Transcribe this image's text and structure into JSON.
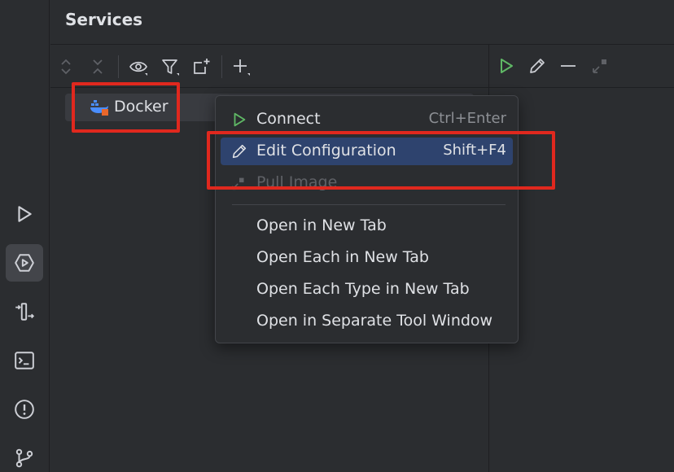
{
  "panel": {
    "title": "Services"
  },
  "left_strip": {
    "icons": [
      "run-icon",
      "services-icon",
      "deploy-icon",
      "terminal-icon",
      "problems-icon",
      "git-icon"
    ],
    "active": "services-icon"
  },
  "toolbar": {
    "icons": [
      "expand-all-icon",
      "collapse-all-icon",
      "eye-icon",
      "filter-icon",
      "new-group-icon",
      "add-icon"
    ]
  },
  "tree": {
    "items": [
      {
        "label": "Docker",
        "icon": "docker-icon",
        "selected": true
      }
    ]
  },
  "context_menu": {
    "items": [
      {
        "label": "Connect",
        "shortcut": "Ctrl+Enter",
        "icon": "run-icon",
        "enabled": true,
        "selected": false
      },
      {
        "label": "Edit Configuration",
        "shortcut": "Shift+F4",
        "icon": "pencil-icon",
        "enabled": true,
        "selected": true
      },
      {
        "label": "Pull Image",
        "shortcut": "",
        "icon": "pull-image-icon",
        "enabled": false,
        "selected": false
      },
      {
        "label": "Open in New Tab",
        "shortcut": "",
        "icon": "",
        "enabled": true,
        "selected": false
      },
      {
        "label": "Open Each in New Tab",
        "shortcut": "",
        "icon": "",
        "enabled": true,
        "selected": false
      },
      {
        "label": "Open Each Type in New Tab",
        "shortcut": "",
        "icon": "",
        "enabled": true,
        "selected": false
      },
      {
        "label": "Open in Separate Tool Window",
        "shortcut": "",
        "icon": "",
        "enabled": true,
        "selected": false
      }
    ]
  },
  "right_toolbar": {
    "icons": [
      "run-icon",
      "pencil-icon",
      "minus-icon",
      "expand-icon"
    ]
  },
  "colors": {
    "background": "#2b2d30",
    "selection": "#2e436e",
    "run_green": "#5fb865",
    "annotation_red": "#e0281e",
    "docker_blue": "#4a8eff",
    "docker_orange": "#e8672b"
  }
}
